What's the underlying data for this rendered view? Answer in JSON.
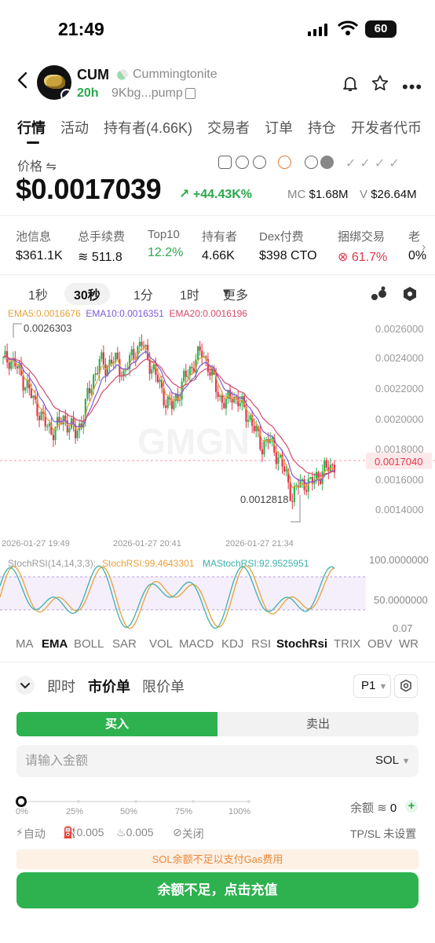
{
  "status_bar": {
    "time": "21:49",
    "battery": "60"
  },
  "token": {
    "symbol": "CUM",
    "name": "Cummingtonite",
    "age": "20h",
    "address": "9Kbg...pump"
  },
  "tabs": [
    "行情",
    "活动",
    "持有者(4.66K)",
    "交易者",
    "订单",
    "持仓",
    "开发者代币"
  ],
  "price": {
    "label": "价格 ⇋",
    "value": "$0.0017039",
    "change": "+44.43K%",
    "mc_label": "MC",
    "mc_value": "$1.68M",
    "vol_label": "V",
    "vol_value": "$26.64M"
  },
  "stats": [
    {
      "key": "池信息",
      "value": "$361.1K",
      "color": "normal"
    },
    {
      "key": "总手续费",
      "value": "511.8",
      "color": "normal"
    },
    {
      "key": "Top10",
      "value": "12.2%",
      "color": "green"
    },
    {
      "key": "持有者",
      "value": "4.66K",
      "color": "normal"
    },
    {
      "key": "Dex付费",
      "value": "$398 CTO",
      "color": "normal"
    },
    {
      "key": "捆绑交易",
      "value": "61.7%",
      "color": "red"
    },
    {
      "key": "老",
      "value": "0%",
      "color": "normal"
    }
  ],
  "intervals": [
    "1秒",
    "30秒",
    "1分",
    "1时",
    "更多"
  ],
  "ema_legend": {
    "ema5": "EMA5:0.0016676",
    "ema10": "EMA10:0.0016351",
    "ema20": "EMA20:0.0016196"
  },
  "chart_data": {
    "type": "candlestick",
    "price_axis_ticks": [
      "0.0026000",
      "0.0024000",
      "0.0022000",
      "0.0020000",
      "0.0018000",
      "0.0016000",
      "0.0014000"
    ],
    "current_price_label": "0.0017040",
    "high_annotation": "0.0026303",
    "low_annotation": "0.0012818",
    "time_ticks": [
      "2026-01-27 19:49",
      "2026-01-27 20:41",
      "2026-01-27 21:34"
    ],
    "watermark": "GMGN",
    "close_trend": [
      0.00238,
      0.0024,
      0.00236,
      0.00228,
      0.00222,
      0.00212,
      0.00205,
      0.00196,
      0.00192,
      0.00195,
      0.002,
      0.00196,
      0.0019,
      0.00198,
      0.00214,
      0.00228,
      0.00238,
      0.00234,
      0.0024,
      0.00236,
      0.0023,
      0.00238,
      0.00246,
      0.0025,
      0.0024,
      0.00232,
      0.00222,
      0.00212,
      0.00208,
      0.00216,
      0.00226,
      0.00232,
      0.0024,
      0.00244,
      0.00236,
      0.00224,
      0.00214,
      0.0021,
      0.00216,
      0.00212,
      0.00206,
      0.002,
      0.0019,
      0.00182,
      0.00186,
      0.0018,
      0.00172,
      0.00162,
      0.00148,
      0.00156,
      0.00158,
      0.00156,
      0.00162,
      0.00164,
      0.00168,
      0.0017
    ]
  },
  "stoch_rsi": {
    "label": "StochRSI(14,14,3,3):",
    "value": "StochRSI:99.4643301",
    "ma_value": "MAStochRSI:92.9525951",
    "axis": [
      "100.0000000",
      "50.0000000",
      "0.07"
    ]
  },
  "indicators": [
    "MA",
    "EMA",
    "BOLL",
    "SAR",
    "VOL",
    "MACD",
    "KDJ",
    "RSI",
    "StochRsi",
    "TRIX",
    "OBV",
    "WR"
  ],
  "order": {
    "types": [
      "即时",
      "市价单",
      "限价单"
    ],
    "preset": "P1",
    "buy_label": "买入",
    "sell_label": "卖出",
    "amount_placeholder": "请输入金额",
    "currency": "SOL",
    "slider_marks": [
      "0%",
      "25%",
      "50%",
      "75%",
      "100%"
    ],
    "balance_label": "余额",
    "balance_value": "0",
    "auto_label": "自动",
    "fee1": "0.005",
    "fee2": "0.005",
    "mev_label": "关闭",
    "tpsl": "TP/SL 未设置",
    "warning": "SOL余额不足以支付Gas费用",
    "deposit_button": "余额不足，点击充值"
  },
  "colors": {
    "green": "#2db24f",
    "red": "#e0384b",
    "ema5": "#e6a23c",
    "ema10": "#7b5ad6",
    "ema20": "#d6496b"
  }
}
